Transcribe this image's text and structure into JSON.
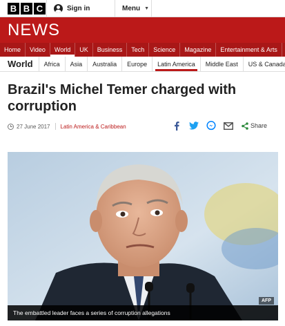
{
  "brand": {
    "letters": [
      "B",
      "B",
      "C"
    ],
    "signin_label": "Sign in",
    "menu_label": "Menu",
    "news_title": "NEWS"
  },
  "main_nav": [
    {
      "label": "Home",
      "active": false
    },
    {
      "label": "Video",
      "active": false
    },
    {
      "label": "World",
      "active": true
    },
    {
      "label": "UK",
      "active": false
    },
    {
      "label": "Business",
      "active": false
    },
    {
      "label": "Tech",
      "active": false
    },
    {
      "label": "Science",
      "active": false
    },
    {
      "label": "Magazine",
      "active": false
    },
    {
      "label": "Entertainment & Arts",
      "active": false
    }
  ],
  "section_nav": {
    "title": "World",
    "items": [
      {
        "label": "Africa",
        "active": false
      },
      {
        "label": "Asia",
        "active": false
      },
      {
        "label": "Australia",
        "active": false
      },
      {
        "label": "Europe",
        "active": false
      },
      {
        "label": "Latin America",
        "active": true
      },
      {
        "label": "Middle East",
        "active": false
      },
      {
        "label": "US & Canada",
        "active": false
      }
    ]
  },
  "article": {
    "headline": "Brazil's Michel Temer charged with corruption",
    "date": "27 June 2017",
    "category": "Latin America & Caribbean",
    "share_label": "Share",
    "image_credit": "AFP",
    "image_caption": "The embattled leader faces a series of corruption allegations"
  },
  "colors": {
    "brand_red": "#bb1919",
    "nav_red": "#a91717",
    "facebook": "#3b5998",
    "twitter": "#1da1f2",
    "messenger": "#0084ff",
    "share_green": "#2e8b3d"
  },
  "icons": [
    "user-icon",
    "chevron-down-icon",
    "clock-icon",
    "facebook-icon",
    "twitter-icon",
    "messenger-icon",
    "email-icon",
    "share-icon"
  ]
}
